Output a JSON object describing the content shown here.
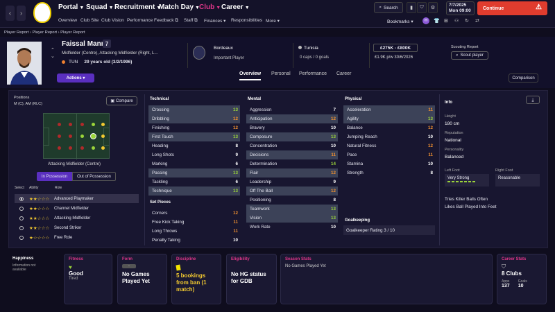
{
  "topbar": {
    "menus": [
      "Portal",
      "Squad",
      "Recruitment",
      "Match Day",
      "Club",
      "Career"
    ],
    "submenu": [
      "Overview",
      "Club Site",
      "Club Vision",
      "Performance Feedback",
      "Staff",
      "Finances",
      "Responsibilities",
      "More"
    ],
    "search": "Search",
    "bookmarks": "Bookmarks",
    "date": "7/7/2025",
    "day_time": "Mon  09:00",
    "continue": "Continue"
  },
  "breadcrumb": "Player Report  ›  Player Report  ›  Player Report",
  "player": {
    "name": "Faissal Mannai",
    "number": "7",
    "position": "Midfielder (Centre), Attacking Midfielder (Right, L...",
    "nationality": "TUN",
    "age": "29 years old (3/2/1996)",
    "actions": "Actions",
    "club": "Bordeaux",
    "status": "Important Player",
    "country": "Tunisia",
    "caps": "0 caps / 0 goals",
    "value": "£275K - £800K",
    "wage": "£1.9K p/w  30/6/2026",
    "scouting_title": "Scouting Report",
    "scout_btn": "Scout player"
  },
  "tabs": [
    "Overview",
    "Personal",
    "Performance",
    "Career"
  ],
  "comparison": "Comparison",
  "positions": {
    "title": "Positions",
    "value": "M (C), AM (RLC)",
    "compare": "Compare",
    "role_caption": "Attacking Midfielder (Centre)",
    "in_poss": "In Possession",
    "out_poss": "Out of Possession",
    "headers": [
      "Select",
      "Ability",
      "Role"
    ],
    "roles": [
      {
        "name": "Advanced Playmaker",
        "stars": "★★☆☆☆"
      },
      {
        "name": "Channel Midfielder",
        "stars": "★★☆☆☆"
      },
      {
        "name": "Attacking Midfielder",
        "stars": "★★☆☆☆"
      },
      {
        "name": "Second Striker",
        "stars": "★★☆☆☆"
      },
      {
        "name": "Free Role",
        "stars": "★☆☆☆☆"
      }
    ]
  },
  "technical": {
    "title": "Technical",
    "rows": [
      [
        "Crossing",
        "13"
      ],
      [
        "Dribbling",
        "12"
      ],
      [
        "Finishing",
        "12"
      ],
      [
        "First Touch",
        "13"
      ],
      [
        "Heading",
        "8"
      ],
      [
        "Long Shots",
        "9"
      ],
      [
        "Marking",
        "6"
      ],
      [
        "Passing",
        "13"
      ],
      [
        "Tackling",
        "6"
      ],
      [
        "Technique",
        "13"
      ]
    ]
  },
  "setpieces": {
    "title": "Set Pieces",
    "rows": [
      [
        "Corners",
        "12"
      ],
      [
        "Free Kick Taking",
        "11"
      ],
      [
        "Long Throws",
        "11"
      ],
      [
        "Penalty Taking",
        "10"
      ]
    ]
  },
  "mental": {
    "title": "Mental",
    "rows": [
      [
        "Aggression",
        "7"
      ],
      [
        "Anticipation",
        "12"
      ],
      [
        "Bravery",
        "10"
      ],
      [
        "Composure",
        "13"
      ],
      [
        "Concentration",
        "10"
      ],
      [
        "Decisions",
        "11"
      ],
      [
        "Determination",
        "14"
      ],
      [
        "Flair",
        "12"
      ],
      [
        "Leadership",
        "9"
      ],
      [
        "Off The Ball",
        "12"
      ],
      [
        "Positioning",
        "8"
      ],
      [
        "Teamwork",
        "13"
      ],
      [
        "Vision",
        "13"
      ],
      [
        "Work Rate",
        "10"
      ]
    ]
  },
  "physical": {
    "title": "Physical",
    "rows": [
      [
        "Acceleration",
        "11"
      ],
      [
        "Agility",
        "13"
      ],
      [
        "Balance",
        "12"
      ],
      [
        "Jumping Reach",
        "10"
      ],
      [
        "Natural Fitness",
        "12"
      ],
      [
        "Pace",
        "11"
      ],
      [
        "Stamina",
        "10"
      ],
      [
        "Strength",
        "8"
      ]
    ]
  },
  "goalkeeping": {
    "title": "Goalkeeping",
    "rating": "Goalkeeper Rating  3 / 10"
  },
  "info": {
    "title": "Info",
    "height_label": "Height",
    "height": "180 cm",
    "rep_label": "Reputation",
    "rep": "National",
    "pers_label": "Personality",
    "pers": "Balanced",
    "lf_label": "Left Foot",
    "lf": "Very Strong",
    "rf_label": "Right Foot",
    "rf": "Reasonable",
    "traits": [
      "Tries Killer Balls Often",
      "Likes Ball Played Into Feet"
    ]
  },
  "cards": {
    "happiness": {
      "title": "Happiness",
      "text": "Information not available"
    },
    "fitness": {
      "title": "Fitness",
      "big": "Good",
      "sm": "Tired"
    },
    "form": {
      "title": "Form",
      "badge": "-",
      "big": "No Games Played Yet"
    },
    "discipline": {
      "title": "Discipline",
      "big": "5 bookings from ban (1 match)"
    },
    "eligibility": {
      "title": "Eligibility",
      "big": "No HG status for GDB"
    },
    "season": {
      "title": "Season Stats",
      "text": "No Games Played Yet"
    },
    "career": {
      "title": "Career Stats",
      "big": "8 Clubs",
      "apps_label": "Apps",
      "apps": "137",
      "goals_label": "Goals",
      "goals": "10"
    }
  },
  "colors": {
    "accent": "#e0368a",
    "continue": "#e03c2e",
    "actions": "#5a2fc0"
  }
}
